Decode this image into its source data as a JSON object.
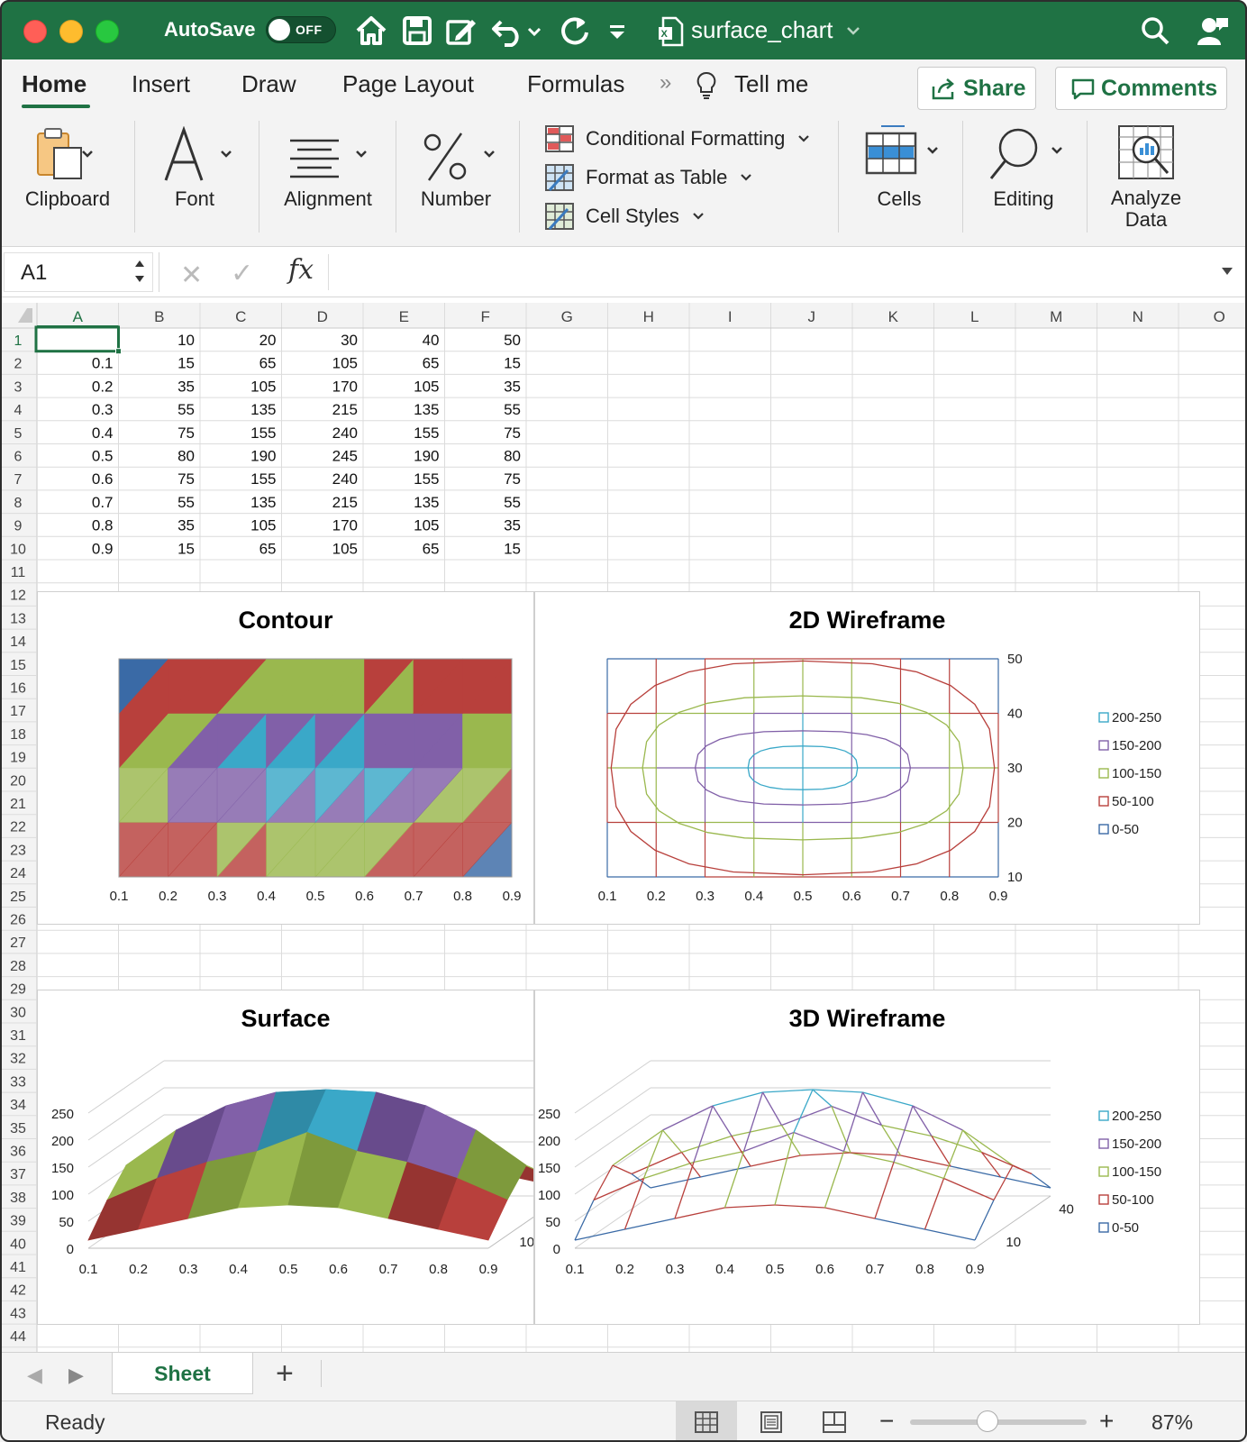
{
  "titlebar": {
    "autosave_label": "AutoSave",
    "autosave_state": "OFF",
    "document_title": "surface_chart",
    "icons": [
      "home-icon",
      "save-icon",
      "edit-icon",
      "undo-icon",
      "redo-icon",
      "customize-icon",
      "search-icon",
      "account-icon"
    ]
  },
  "ribbon_tabs": {
    "home": "Home",
    "insert": "Insert",
    "draw": "Draw",
    "page_layout": "Page Layout",
    "formulas": "Formulas",
    "more": "»",
    "tell_me": "Tell me",
    "share": "Share",
    "comments": "Comments"
  },
  "ribbon": {
    "clipboard": "Clipboard",
    "font": "Font",
    "alignment": "Alignment",
    "number": "Number",
    "conditional_formatting": "Conditional Formatting",
    "format_as_table": "Format as Table",
    "cell_styles": "Cell Styles",
    "cells": "Cells",
    "editing": "Editing",
    "analyze_data_line1": "Analyze",
    "analyze_data_line2": "Data"
  },
  "formula_bar": {
    "name_box": "A1",
    "formula": ""
  },
  "sheet": {
    "columns": [
      "A",
      "B",
      "C",
      "D",
      "E",
      "F",
      "G",
      "H",
      "I",
      "J",
      "K",
      "L",
      "M",
      "N",
      "O"
    ],
    "selected_cell": "A1",
    "row_count_visible": 44,
    "rows": [
      [
        "",
        "10",
        "20",
        "30",
        "40",
        "50"
      ],
      [
        "0.1",
        "15",
        "65",
        "105",
        "65",
        "15"
      ],
      [
        "0.2",
        "35",
        "105",
        "170",
        "105",
        "35"
      ],
      [
        "0.3",
        "55",
        "135",
        "215",
        "135",
        "55"
      ],
      [
        "0.4",
        "75",
        "155",
        "240",
        "155",
        "75"
      ],
      [
        "0.5",
        "80",
        "190",
        "245",
        "190",
        "80"
      ],
      [
        "0.6",
        "75",
        "155",
        "240",
        "155",
        "75"
      ],
      [
        "0.7",
        "55",
        "135",
        "215",
        "135",
        "55"
      ],
      [
        "0.8",
        "35",
        "105",
        "170",
        "105",
        "35"
      ],
      [
        "0.9",
        "15",
        "65",
        "105",
        "65",
        "15"
      ]
    ]
  },
  "chart_data": [
    {
      "type": "heatmap",
      "title": "Contour",
      "x": [
        0.1,
        0.2,
        0.3,
        0.4,
        0.5,
        0.6,
        0.7,
        0.8,
        0.9
      ],
      "y": [
        10,
        20,
        30,
        40,
        50
      ],
      "z": [
        [
          15,
          35,
          55,
          75,
          80,
          75,
          55,
          35,
          15
        ],
        [
          65,
          105,
          135,
          155,
          190,
          155,
          135,
          105,
          65
        ],
        [
          105,
          170,
          215,
          240,
          245,
          240,
          215,
          170,
          105
        ],
        [
          65,
          105,
          135,
          155,
          190,
          155,
          135,
          105,
          65
        ],
        [
          15,
          35,
          55,
          75,
          80,
          75,
          55,
          35,
          15
        ]
      ],
      "xticks": [
        "0.1",
        "0.2",
        "0.3",
        "0.4",
        "0.5",
        "0.6",
        "0.7",
        "0.8",
        "0.9"
      ],
      "band_colors": [
        "#3a6aa6",
        "#b8403c",
        "#9ab84e",
        "#8160a8",
        "#3aa8c8"
      ]
    },
    {
      "type": "line",
      "title": "2D Wireframe",
      "x": [
        0.1,
        0.2,
        0.3,
        0.4,
        0.5,
        0.6,
        0.7,
        0.8,
        0.9
      ],
      "y": [
        10,
        20,
        30,
        40,
        50
      ],
      "xticks": [
        "0.1",
        "0.2",
        "0.3",
        "0.4",
        "0.5",
        "0.6",
        "0.7",
        "0.8",
        "0.9"
      ],
      "yticks": [
        "10",
        "20",
        "30",
        "40",
        "50"
      ],
      "legend": [
        "200-250",
        "150-200",
        "100-150",
        "50-100",
        "0-50"
      ],
      "legend_colors": [
        "#3aa8c8",
        "#8160a8",
        "#9ab84e",
        "#b8403c",
        "#3a6aa6"
      ],
      "legend_position": "right"
    },
    {
      "type": "area",
      "title": "Surface",
      "xticks": [
        "0.1",
        "0.2",
        "0.3",
        "0.4",
        "0.5",
        "0.6",
        "0.7",
        "0.8",
        "0.9"
      ],
      "zticks": [
        "0",
        "50",
        "100",
        "150",
        "200",
        "250"
      ],
      "depth_ticks": [
        "10"
      ],
      "ylim": [
        0,
        250
      ]
    },
    {
      "type": "line",
      "title": "3D Wireframe",
      "xticks": [
        "0.1",
        "0.2",
        "0.3",
        "0.4",
        "0.5",
        "0.6",
        "0.7",
        "0.8",
        "0.9"
      ],
      "zticks": [
        "0",
        "50",
        "100",
        "150",
        "200",
        "250"
      ],
      "depth_ticks": [
        "10",
        "40"
      ],
      "legend": [
        "200-250",
        "150-200",
        "100-150",
        "50-100",
        "0-50"
      ],
      "legend_colors": [
        "#3aa8c8",
        "#8160a8",
        "#9ab84e",
        "#b8403c",
        "#3a6aa6"
      ],
      "legend_position": "right",
      "ylim": [
        0,
        250
      ]
    }
  ],
  "sheet_tabs": {
    "active": "Sheet",
    "add": "+"
  },
  "statusbar": {
    "ready": "Ready",
    "zoom_minus": "−",
    "zoom_plus": "+",
    "zoom_level": "87%",
    "zoom_fraction": 0.44
  },
  "colors": {
    "brand": "#1f7244",
    "gridline": "#d9d9d9",
    "header_bg": "#f3f3f3"
  }
}
